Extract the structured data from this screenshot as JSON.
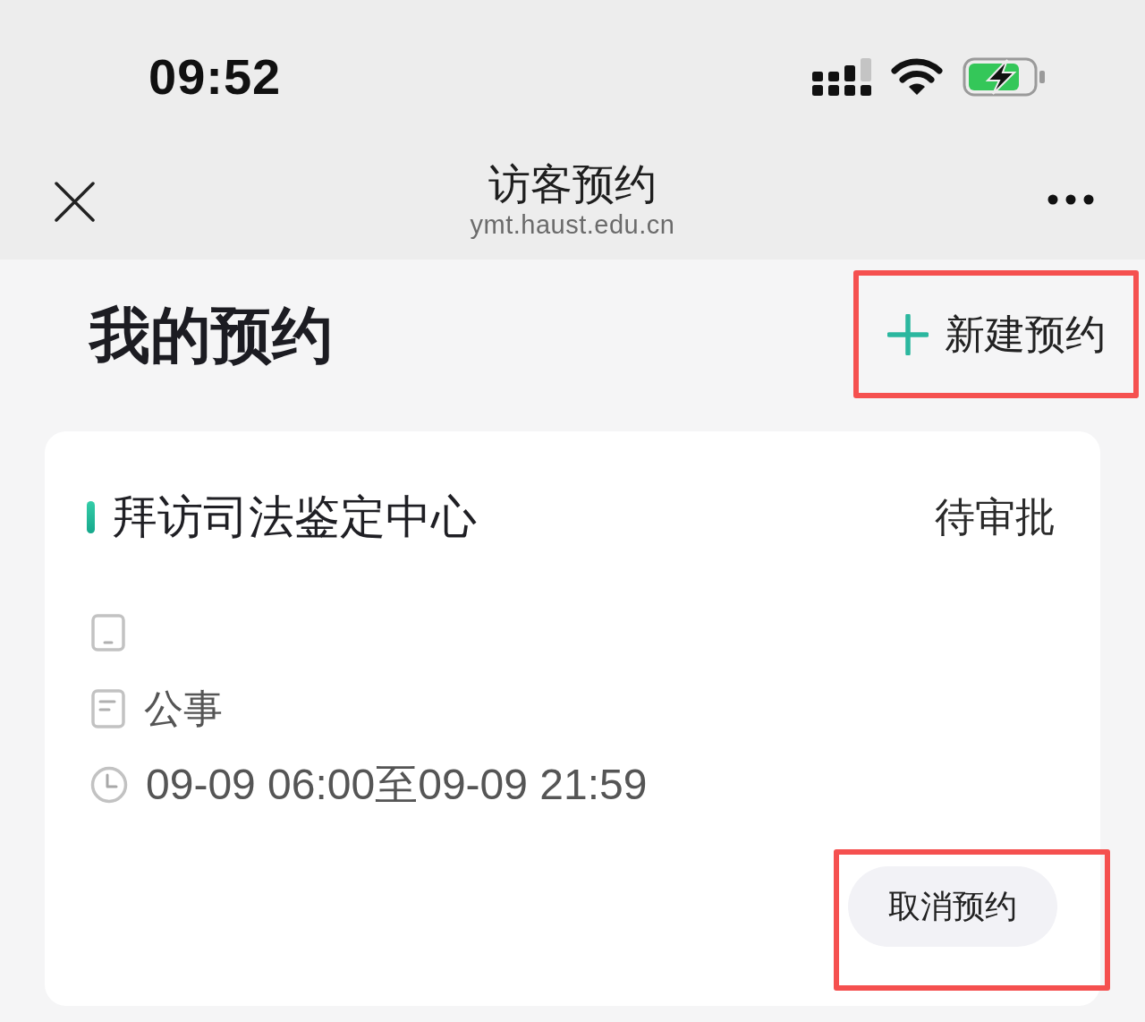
{
  "status_bar": {
    "time": "09:52"
  },
  "nav_bar": {
    "title": "访客预约",
    "subtitle": "ymt.haust.edu.cn"
  },
  "header": {
    "title": "我的预约",
    "new_button": {
      "label": "新建预约",
      "highlighted": true
    }
  },
  "appointments": [
    {
      "title": "拜访司法鉴定中心",
      "status": "待审批",
      "details": [
        {
          "kind": "phone"
        },
        {
          "kind": "purpose",
          "text": "公事"
        },
        {
          "kind": "time",
          "text": "09-09 06:00至09-09 21:59"
        }
      ],
      "cancel_button": {
        "label": "取消预约",
        "highlighted": true
      }
    }
  ]
}
